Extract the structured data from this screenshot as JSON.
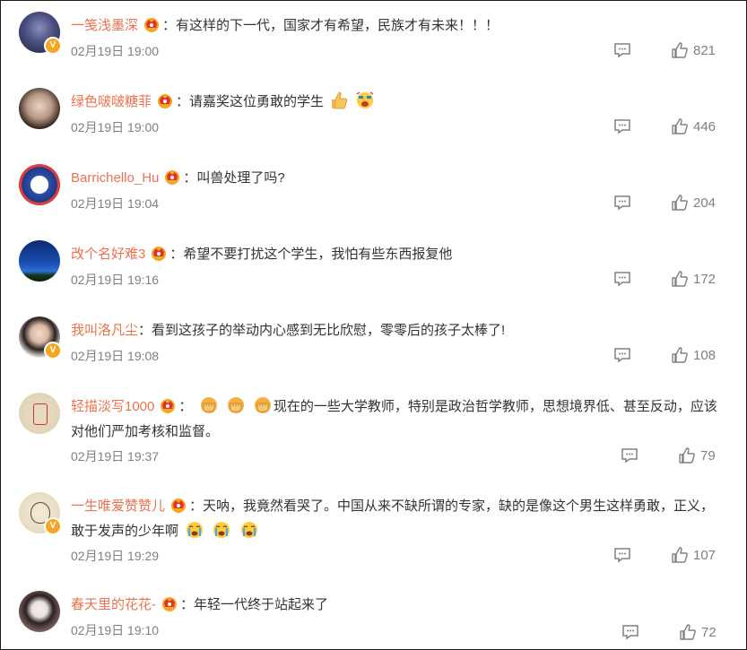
{
  "comments": [
    {
      "user": "一笺浅墨深",
      "text": "：有这样的下一代，国家才有希望，民族才有未来！！！",
      "time": "02月19日 19:00",
      "likes": "821",
      "verified": true
    },
    {
      "user": "绿色啵啵糖菲",
      "text": "：请嘉奖这位勇敢的学生",
      "time": "02月19日 19:00",
      "likes": "446",
      "verified": false
    },
    {
      "user": "Barrichello_Hu",
      "text": "：叫兽处理了吗?",
      "time": "02月19日 19:04",
      "likes": "204",
      "verified": false
    },
    {
      "user": "改个名好难3",
      "text": "：希望不要打扰这个学生，我怕有些东西报复他",
      "time": "02月19日 19:16",
      "likes": "172",
      "verified": false
    },
    {
      "user": "我叫洛凡尘",
      "text": "：看到这孩子的举动内心感到无比欣慰，零零后的孩子太棒了!",
      "time": "02月19日 19:08",
      "likes": "108",
      "verified": true
    },
    {
      "user": "轻描淡写1000",
      "text": "现在的一些大学教师，特别是政治哲学教师，思想境界低、甚至反动，应该对他们严加考核和监督。",
      "time": "02月19日 19:37",
      "likes": "79",
      "verified": false
    },
    {
      "user": "一生唯爱赞赞儿",
      "text": "：天呐，我竟然看哭了。中国从来不缺所谓的专家，缺的是像这个男生这样勇敢，正义，敢于发声的少年啊",
      "time": "02月19日 19:29",
      "likes": "107",
      "verified": true
    },
    {
      "user": "春天里的花花-",
      "text": "：年轻一代终于站起来了",
      "time": "02月19日 19:10",
      "likes": "72",
      "verified": false
    }
  ],
  "icons": {
    "reply": "comment-icon",
    "like": "thumb-up-icon",
    "badge": "vip-crown-icon",
    "verified": "verified-v-icon"
  },
  "colors": {
    "username": "#eb7350",
    "meta": "#808080",
    "badge": "#f5a623"
  }
}
